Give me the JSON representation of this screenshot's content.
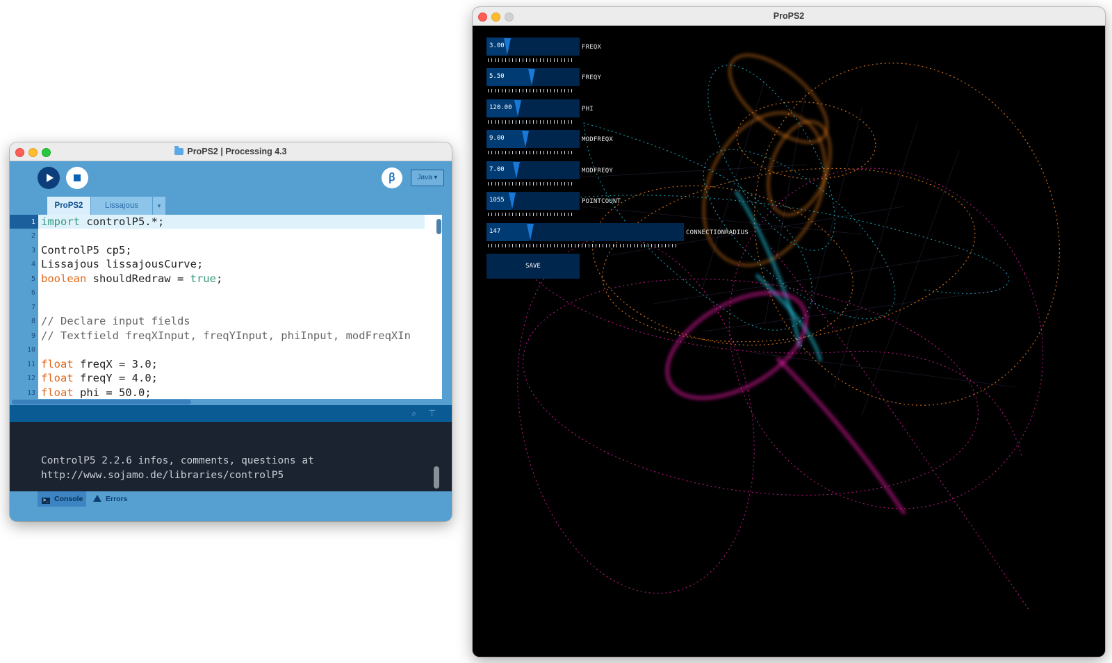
{
  "ide": {
    "window_title": "ProPS2 | Processing 4.3",
    "mode": "Java",
    "debug_icon": "butterfly-debug-icon",
    "tabs": [
      {
        "label": "ProPS2",
        "active": true
      },
      {
        "label": "Lissajous",
        "active": false
      }
    ],
    "tab_menu_glyph": "▾",
    "line_numbers": [
      "1",
      "2",
      "3",
      "4",
      "5",
      "6",
      "7",
      "8",
      "9",
      "10",
      "11",
      "12",
      "13"
    ],
    "code": {
      "l1_kw": "import",
      "l1_rest": " controlP5.*;",
      "l3": "ControlP5 cp5;",
      "l4": "Lissajous lissajousCurve;",
      "l5_kw": "boolean",
      "l5_mid": " shouldRedraw = ",
      "l5_val": "true",
      "l5_end": ";",
      "l8": "// Declare input fields",
      "l9": "// Textfield freqXInput, freqYInput, phiInput, modFreqXIn",
      "l11_kw": "float",
      "l11_rest": " freqX = 3.0;",
      "l12_kw": "float",
      "l12_rest": " freqY = 4.0;",
      "l13_kw": "float",
      "l13_rest": " phi = 50.0;"
    },
    "console_lines": [
      "ControlP5 2.2.6 infos, comments, questions at",
      "http://www.sojamo.de/libraries/controlP5"
    ],
    "footer": {
      "console_label": "Console",
      "errors_label": "Errors"
    }
  },
  "sketch": {
    "window_title": "ProPS2",
    "sliders": [
      {
        "name": "FREQX",
        "value": "3.00",
        "level": 0.22
      },
      {
        "name": "FREQY",
        "value": "5.50",
        "level": 0.48
      },
      {
        "name": "PHI",
        "value": "120.00",
        "level": 0.33
      },
      {
        "name": "MODFREQX",
        "value": "9.00",
        "level": 0.41
      },
      {
        "name": "MODFREQY",
        "value": "7.00",
        "level": 0.31
      },
      {
        "name": "POINTCOUNT",
        "value": "1055",
        "level": 0.27
      },
      {
        "name": "CONNECTIONRADIUS",
        "value": "147",
        "level": 0.22
      }
    ],
    "save_label": "SAVE",
    "colors": {
      "slider_bg": "#00264d",
      "slider_fill": "#003b74",
      "slider_knob": "#1a78d6",
      "curve_orange": "#ff8a1f",
      "curve_magenta": "#ff1fb4",
      "curve_cyan": "#27d3f0"
    }
  }
}
